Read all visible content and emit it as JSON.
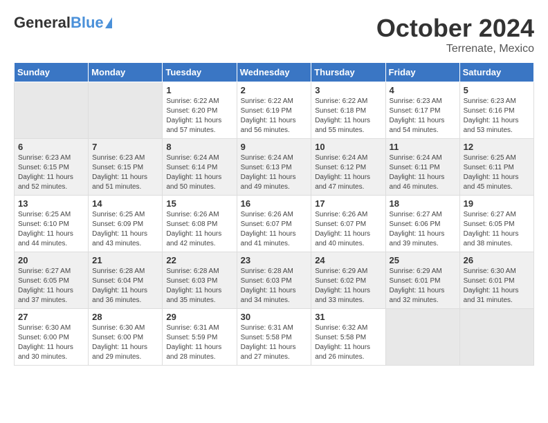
{
  "header": {
    "logo_general": "General",
    "logo_blue": "Blue",
    "month": "October 2024",
    "location": "Terrenate, Mexico"
  },
  "weekdays": [
    "Sunday",
    "Monday",
    "Tuesday",
    "Wednesday",
    "Thursday",
    "Friday",
    "Saturday"
  ],
  "weeks": [
    [
      {
        "day": "",
        "sunrise": "",
        "sunset": "",
        "daylight": "",
        "empty": true
      },
      {
        "day": "",
        "sunrise": "",
        "sunset": "",
        "daylight": "",
        "empty": true
      },
      {
        "day": "1",
        "sunrise": "Sunrise: 6:22 AM",
        "sunset": "Sunset: 6:20 PM",
        "daylight": "Daylight: 11 hours and 57 minutes."
      },
      {
        "day": "2",
        "sunrise": "Sunrise: 6:22 AM",
        "sunset": "Sunset: 6:19 PM",
        "daylight": "Daylight: 11 hours and 56 minutes."
      },
      {
        "day": "3",
        "sunrise": "Sunrise: 6:22 AM",
        "sunset": "Sunset: 6:18 PM",
        "daylight": "Daylight: 11 hours and 55 minutes."
      },
      {
        "day": "4",
        "sunrise": "Sunrise: 6:23 AM",
        "sunset": "Sunset: 6:17 PM",
        "daylight": "Daylight: 11 hours and 54 minutes."
      },
      {
        "day": "5",
        "sunrise": "Sunrise: 6:23 AM",
        "sunset": "Sunset: 6:16 PM",
        "daylight": "Daylight: 11 hours and 53 minutes."
      }
    ],
    [
      {
        "day": "6",
        "sunrise": "Sunrise: 6:23 AM",
        "sunset": "Sunset: 6:15 PM",
        "daylight": "Daylight: 11 hours and 52 minutes."
      },
      {
        "day": "7",
        "sunrise": "Sunrise: 6:23 AM",
        "sunset": "Sunset: 6:15 PM",
        "daylight": "Daylight: 11 hours and 51 minutes."
      },
      {
        "day": "8",
        "sunrise": "Sunrise: 6:24 AM",
        "sunset": "Sunset: 6:14 PM",
        "daylight": "Daylight: 11 hours and 50 minutes."
      },
      {
        "day": "9",
        "sunrise": "Sunrise: 6:24 AM",
        "sunset": "Sunset: 6:13 PM",
        "daylight": "Daylight: 11 hours and 49 minutes."
      },
      {
        "day": "10",
        "sunrise": "Sunrise: 6:24 AM",
        "sunset": "Sunset: 6:12 PM",
        "daylight": "Daylight: 11 hours and 47 minutes."
      },
      {
        "day": "11",
        "sunrise": "Sunrise: 6:24 AM",
        "sunset": "Sunset: 6:11 PM",
        "daylight": "Daylight: 11 hours and 46 minutes."
      },
      {
        "day": "12",
        "sunrise": "Sunrise: 6:25 AM",
        "sunset": "Sunset: 6:11 PM",
        "daylight": "Daylight: 11 hours and 45 minutes."
      }
    ],
    [
      {
        "day": "13",
        "sunrise": "Sunrise: 6:25 AM",
        "sunset": "Sunset: 6:10 PM",
        "daylight": "Daylight: 11 hours and 44 minutes."
      },
      {
        "day": "14",
        "sunrise": "Sunrise: 6:25 AM",
        "sunset": "Sunset: 6:09 PM",
        "daylight": "Daylight: 11 hours and 43 minutes."
      },
      {
        "day": "15",
        "sunrise": "Sunrise: 6:26 AM",
        "sunset": "Sunset: 6:08 PM",
        "daylight": "Daylight: 11 hours and 42 minutes."
      },
      {
        "day": "16",
        "sunrise": "Sunrise: 6:26 AM",
        "sunset": "Sunset: 6:07 PM",
        "daylight": "Daylight: 11 hours and 41 minutes."
      },
      {
        "day": "17",
        "sunrise": "Sunrise: 6:26 AM",
        "sunset": "Sunset: 6:07 PM",
        "daylight": "Daylight: 11 hours and 40 minutes."
      },
      {
        "day": "18",
        "sunrise": "Sunrise: 6:27 AM",
        "sunset": "Sunset: 6:06 PM",
        "daylight": "Daylight: 11 hours and 39 minutes."
      },
      {
        "day": "19",
        "sunrise": "Sunrise: 6:27 AM",
        "sunset": "Sunset: 6:05 PM",
        "daylight": "Daylight: 11 hours and 38 minutes."
      }
    ],
    [
      {
        "day": "20",
        "sunrise": "Sunrise: 6:27 AM",
        "sunset": "Sunset: 6:05 PM",
        "daylight": "Daylight: 11 hours and 37 minutes."
      },
      {
        "day": "21",
        "sunrise": "Sunrise: 6:28 AM",
        "sunset": "Sunset: 6:04 PM",
        "daylight": "Daylight: 11 hours and 36 minutes."
      },
      {
        "day": "22",
        "sunrise": "Sunrise: 6:28 AM",
        "sunset": "Sunset: 6:03 PM",
        "daylight": "Daylight: 11 hours and 35 minutes."
      },
      {
        "day": "23",
        "sunrise": "Sunrise: 6:28 AM",
        "sunset": "Sunset: 6:03 PM",
        "daylight": "Daylight: 11 hours and 34 minutes."
      },
      {
        "day": "24",
        "sunrise": "Sunrise: 6:29 AM",
        "sunset": "Sunset: 6:02 PM",
        "daylight": "Daylight: 11 hours and 33 minutes."
      },
      {
        "day": "25",
        "sunrise": "Sunrise: 6:29 AM",
        "sunset": "Sunset: 6:01 PM",
        "daylight": "Daylight: 11 hours and 32 minutes."
      },
      {
        "day": "26",
        "sunrise": "Sunrise: 6:30 AM",
        "sunset": "Sunset: 6:01 PM",
        "daylight": "Daylight: 11 hours and 31 minutes."
      }
    ],
    [
      {
        "day": "27",
        "sunrise": "Sunrise: 6:30 AM",
        "sunset": "Sunset: 6:00 PM",
        "daylight": "Daylight: 11 hours and 30 minutes."
      },
      {
        "day": "28",
        "sunrise": "Sunrise: 6:30 AM",
        "sunset": "Sunset: 6:00 PM",
        "daylight": "Daylight: 11 hours and 29 minutes."
      },
      {
        "day": "29",
        "sunrise": "Sunrise: 6:31 AM",
        "sunset": "Sunset: 5:59 PM",
        "daylight": "Daylight: 11 hours and 28 minutes."
      },
      {
        "day": "30",
        "sunrise": "Sunrise: 6:31 AM",
        "sunset": "Sunset: 5:58 PM",
        "daylight": "Daylight: 11 hours and 27 minutes."
      },
      {
        "day": "31",
        "sunrise": "Sunrise: 6:32 AM",
        "sunset": "Sunset: 5:58 PM",
        "daylight": "Daylight: 11 hours and 26 minutes."
      },
      {
        "day": "",
        "sunrise": "",
        "sunset": "",
        "daylight": "",
        "empty": true
      },
      {
        "day": "",
        "sunrise": "",
        "sunset": "",
        "daylight": "",
        "empty": true
      }
    ]
  ]
}
